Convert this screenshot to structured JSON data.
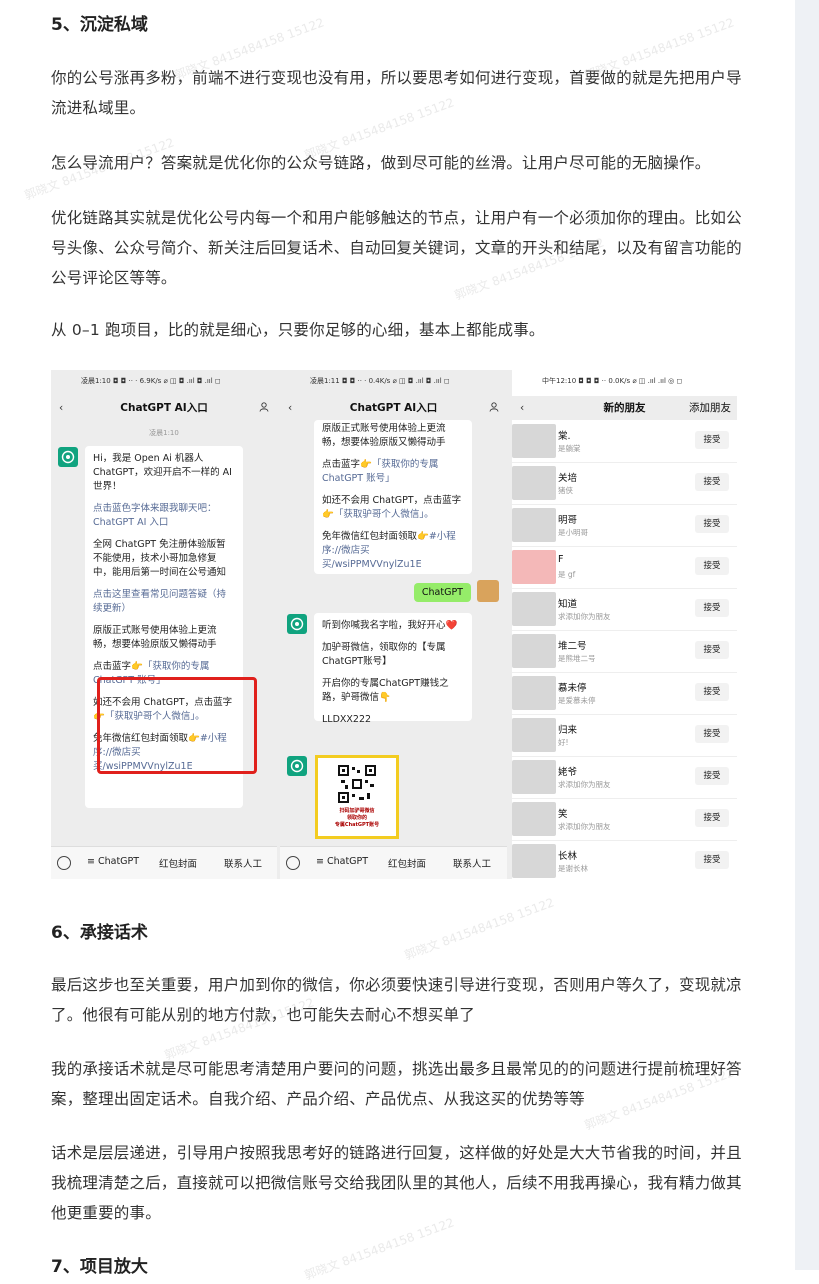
{
  "sections": [
    {
      "heading": "5、沉淀私域"
    },
    {
      "heading": "6、承接话术"
    },
    {
      "heading": "7、项目放大"
    }
  ],
  "paragraphs": [
    "你的公号涨再多粉，前端不进行变现也没有用，所以要思考如何进行变现，首要做的就是先把用户导流进私域里。",
    "怎么导流用户？答案就是优化你的公众号链路，做到尽可能的丝滑。让用户尽可能的无脑操作。",
    "优化链路其实就是优化公号内每一个和用户能够触达的节点，让用户有一个必须加你的理由。比如公号头像、公众号简介、新关注后回复话术、自动回复关键词，文章的开头和结尾，以及有留言功能的公号评论区等等。",
    "从 0–1 跑项目，比的就是细心，只要你足够的心细，基本上都能成事。",
    "最后这步也至关重要，用户加到你的微信，你必须要快速引导进行变现，否则用户等久了，变现就凉了。他很有可能从别的地方付款，也可能失去耐心不想买单了",
    "我的承接话术就是尽可能思考清楚用户要问的问题，挑选出最多且最常见的的问题进行提前梳理好答案，整理出固定话术。自我介绍、产品介绍、产品优点、从我这买的优势等等",
    "话术是层层递进，引导用户按照我思考好的链路进行回复，这样做的好处是大大节省我的时间，并且我梳理清楚之后，直接就可以把微信账号交给我团队里的其他人，后续不用我再操心，我有精力做其他更重要的事。"
  ],
  "screenshot": {
    "panel1": {
      "status": "凌晨1:10 ◘ ◘ ··  ·   6.9K/s ⌀ ◫ ◘ .ııl ◘ .ııl ◻",
      "title": "ChatGPT AI入口",
      "back": "‹",
      "time": "凌晨1:10",
      "bubble": {
        "greeting": "Hi，我是 Open Ai 机器人 ChatGPT，欢迎开启不一样的 AI 世界！",
        "link1": "点击蓝色字体来跟我聊天吧：ChatGPT AI 入口",
        "notice": "全网 ChatGPT 免注册体验版暂不能使用，技术小哥加急修复中，能用后第一时间在公号通知",
        "link2": "点击这里查看常见问题答疑（持续更新）",
        "original": "原版正式账号使用体验上更流畅，想要体验原版又懒得动手",
        "click_blue": "点击蓝字👉",
        "get_account": "「获取你的专属 ChatGPT 账号」",
        "not_use": "如还不会用 ChatGPT，点击蓝字",
        "get_wechat": "👉「获取驴哥个人微信」。",
        "coupon": "免年微信红包封面领取👉",
        "coupon_link": "#小程序://微店买买/wsiPPMVVnylZu1E"
      },
      "bottom": {
        "tab1": "≡ ChatGPT",
        "tab2": "红包封面",
        "tab3": "联系人工"
      }
    },
    "panel2": {
      "status": "凌晨1:11 ◘ ◘ ··  ·   0.4K/s ⌀ ◫ ◘ .ııl ◘ .ııl ◻",
      "title": "ChatGPT AI入口",
      "back": "‹",
      "bubble_top": {
        "line1": "原版正式账号使用体验上更流畅，想要体验原版又懒得动手",
        "click_blue": "点击蓝字👉",
        "get_account": "「获取你的专属 ChatGPT 账号」",
        "not_use": "如还不会用 ChatGPT，点击蓝字",
        "get_wechat": "👉「获取驴哥个人微信」。",
        "coupon": "免年微信红包封面领取👉",
        "coupon_link": "#小程序://微店买买/wsiPPMVVnylZu1E"
      },
      "user_msg": "ChatGPT",
      "reply": {
        "line1": "听到你喊我名字啦，我好开心❤️",
        "line2": "加驴哥微信，领取你的【专属ChatGPT账号】",
        "line3": "开启你的专属ChatGPT赚钱之路，驴哥微信👇",
        "line4": "LLDXX222"
      },
      "qr_caption1": "扫码加驴哥微信",
      "qr_caption2": "领取你的",
      "qr_caption3": "专属ChatGPT账号",
      "bottom": {
        "tab1": "≡ ChatGPT",
        "tab2": "红包封面",
        "tab3": "联系人工"
      }
    },
    "panel3": {
      "status": "中午12:10 ◘ ◘ ◘ ··  0.0K/s ⌀ ◫ .ııl .ııl ◎ ◻",
      "title": "新的朋友",
      "action": "添加朋友",
      "back": "‹",
      "accept": "接受",
      "friends": [
        {
          "name": "棠.",
          "sub": "是躺棠"
        },
        {
          "name": "关培",
          "sub": "猪侠"
        },
        {
          "name": "明哥",
          "sub": "是小明哥"
        },
        {
          "name": "F",
          "sub": "是 gf"
        },
        {
          "name": "知道",
          "sub": "求添加你为朋友"
        },
        {
          "name": "堆二号",
          "sub": "是熊堆二号"
        },
        {
          "name": "慕未停",
          "sub": "是爱慕未停"
        },
        {
          "name": "归来",
          "sub": "好!"
        },
        {
          "name": "姥爷",
          "sub": "求添加你为朋友"
        },
        {
          "name": "笑",
          "sub": "求添加你为朋友"
        },
        {
          "name": "长林",
          "sub": "是谢长林"
        }
      ]
    }
  },
  "watermark": "郭晓文 8415484158 15122",
  "colors": {
    "red_box": "#e0201c",
    "link": "#576b95",
    "wechat_green": "#95ec69",
    "gpt_green": "#10a37f"
  }
}
